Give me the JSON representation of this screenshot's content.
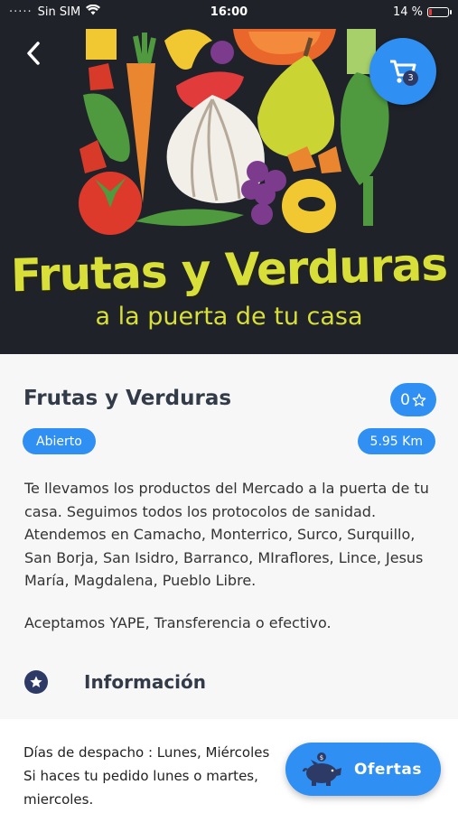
{
  "status_bar": {
    "carrier": "Sin SIM",
    "time": "16:00",
    "battery_percent": "14 %",
    "battery_level": 0.14,
    "icons": [
      "wifi-icon",
      "battery-icon"
    ]
  },
  "hero": {
    "title": "Frutas y Verduras",
    "subtitle": "a la puerta de tu casa",
    "colors": {
      "background": "#1f2229",
      "title": "#d8df39"
    }
  },
  "header_actions": {
    "back_icon": "chevron-left-icon",
    "cart_icon": "cart-icon",
    "cart_count": "3"
  },
  "store": {
    "name": "Frutas y Verduras",
    "rating": "0",
    "rating_icon": "star-outline-icon",
    "status": "Abierto",
    "distance": "5.95 Km",
    "description": "Te llevamos los productos del Mercado a la puerta de tu casa. Seguimos todos los protocolos de sanidad. Atendemos en Camacho, Monterrico, Surco, Surquillo, San Borja, San Isidro, Barranco, MIraflores, Lince, Jesus María, Magdalena, Pueblo Libre.",
    "payment": "Aceptamos YAPE, Transferencia o efectivo."
  },
  "info": {
    "title": "Información",
    "icon": "star-circle-icon",
    "lines": [
      "Días de despacho : Lunes, Miércoles",
      "Si haces tu pedido lunes o martes,",
      "miercoles."
    ]
  },
  "offers": {
    "label": "Ofertas",
    "icon": "piggy-bank-icon"
  },
  "colors": {
    "accent": "#2f8ff2",
    "dark_blue": "#2d3a66",
    "text": "#333b49"
  }
}
